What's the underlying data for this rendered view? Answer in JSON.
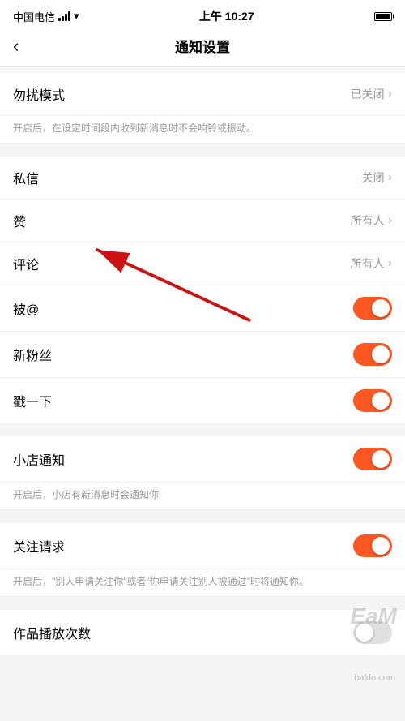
{
  "statusBar": {
    "carrier": "中国电信",
    "time": "上午 10:27"
  },
  "navBar": {
    "backLabel": "‹",
    "title": "通知设置"
  },
  "sections": [
    {
      "id": "dnd",
      "items": [
        {
          "label": "勿扰模式",
          "rightText": "已关闭",
          "type": "arrow"
        }
      ],
      "desc": "开启后，在设定时间段内收到新消息时不会响铃或振动。"
    },
    {
      "id": "messages",
      "items": [
        {
          "label": "私信",
          "rightText": "关闭",
          "type": "arrow"
        },
        {
          "label": "赞",
          "rightText": "所有人",
          "type": "arrow"
        },
        {
          "label": "评论",
          "rightText": "所有人",
          "type": "arrow"
        },
        {
          "label": "被@",
          "rightText": "",
          "type": "toggle",
          "toggleOn": true
        },
        {
          "label": "新粉丝",
          "rightText": "",
          "type": "toggle",
          "toggleOn": true
        },
        {
          "label": "戳一下",
          "rightText": "",
          "type": "toggle",
          "toggleOn": true
        }
      ]
    },
    {
      "id": "shop",
      "items": [
        {
          "label": "小店通知",
          "rightText": "",
          "type": "toggle",
          "toggleOn": true
        }
      ],
      "desc": "开启后，小店有新消息时会通知你"
    },
    {
      "id": "follow",
      "items": [
        {
          "label": "关注请求",
          "rightText": "",
          "type": "toggle",
          "toggleOn": true
        }
      ],
      "desc": "开启后，\"别人申请关注你\"或者\"你申请关注别人被通过\"时将通知你。"
    },
    {
      "id": "plays",
      "items": [
        {
          "label": "作品播放次数",
          "rightText": "",
          "type": "toggle",
          "toggleOn": false
        }
      ]
    }
  ],
  "watermark": "EaM"
}
